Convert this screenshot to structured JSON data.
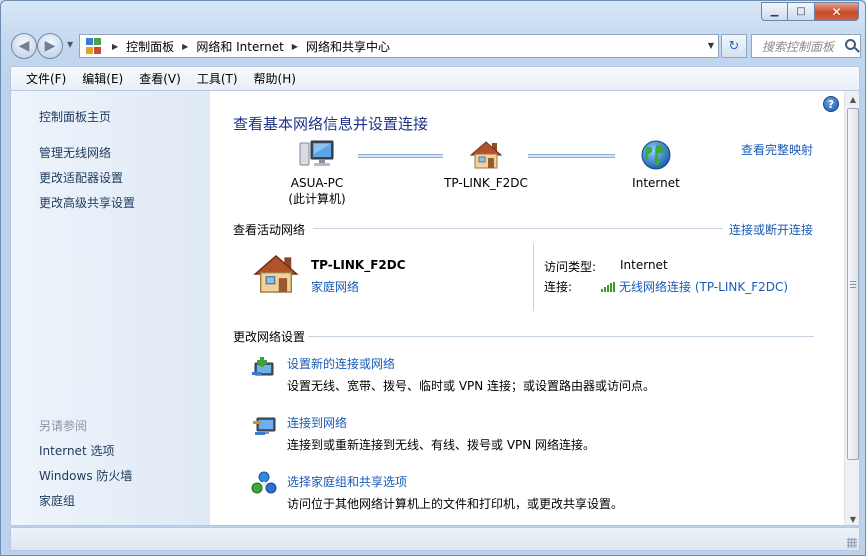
{
  "window": {
    "minimize": "▁",
    "maximize": "□",
    "close": "✕"
  },
  "navigation": {
    "back": "◀",
    "forward": "▶",
    "breadcrumbs": [
      "控制面板",
      "网络和 Internet",
      "网络和共享中心"
    ],
    "refresh": "↻",
    "search_placeholder": "搜索控制面板"
  },
  "menu": [
    "文件(F)",
    "编辑(E)",
    "查看(V)",
    "工具(T)",
    "帮助(H)"
  ],
  "sidebar": {
    "links": [
      "控制面板主页",
      "管理无线网络",
      "更改适配器设置",
      "更改高级共享设置"
    ],
    "see_also_heading": "另请参阅",
    "see_also": [
      "Internet 选项",
      "Windows 防火墙",
      "家庭组"
    ]
  },
  "main": {
    "help": "?",
    "title": "查看基本网络信息并设置连接",
    "full_map_link": "查看完整映射",
    "map": {
      "computer": {
        "name": "ASUA-PC",
        "sub": "(此计算机)",
        "icon": "computer-icon"
      },
      "router": {
        "name": "TP-LINK_F2DC",
        "icon": "house-icon"
      },
      "internet": {
        "name": "Internet",
        "icon": "globe-icon"
      }
    },
    "active_section": "查看活动网络",
    "connect_link": "连接或断开连接",
    "active_network": {
      "name": "TP-LINK_F2DC",
      "type_link": "家庭网络",
      "access_label": "访问类型:",
      "access_value": "Internet",
      "connection_label": "连接:",
      "connection_value": "无线网络连接 (TP-LINK_F2DC)"
    },
    "change_section": "更改网络设置",
    "tasks": [
      {
        "link": "设置新的连接或网络",
        "desc": "设置无线、宽带、拨号、临时或 VPN 连接；或设置路由器或访问点。",
        "icon": "new-connection-icon"
      },
      {
        "link": "连接到网络",
        "desc": "连接到或重新连接到无线、有线、拨号或 VPN 网络连接。",
        "icon": "connect-network-icon"
      },
      {
        "link": "选择家庭组和共享选项",
        "desc": "访问位于其他网络计算机上的文件和打印机，或更改共享设置。",
        "icon": "homegroup-icon"
      }
    ]
  },
  "colors": {
    "link": "#1a5bb5",
    "title": "#1e3287",
    "sidebar_link": "#1e395b",
    "signal": "#3a9b2c"
  }
}
